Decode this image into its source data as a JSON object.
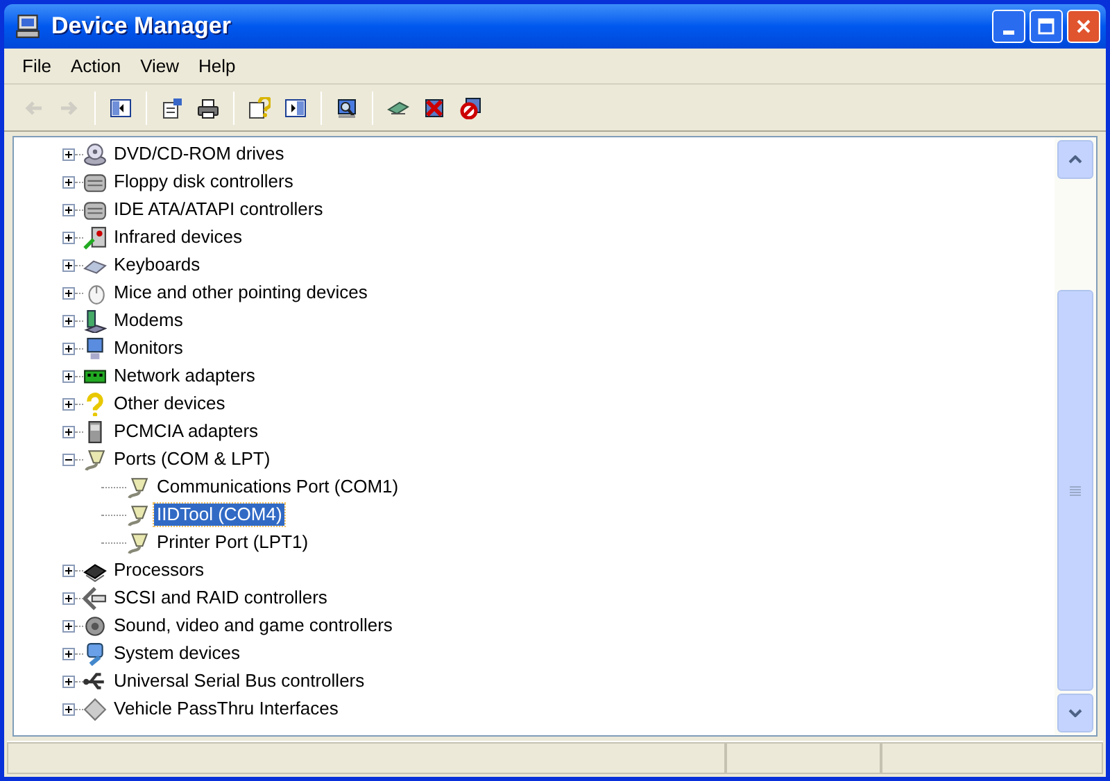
{
  "window": {
    "title": "Device Manager"
  },
  "menu": [
    "File",
    "Action",
    "View",
    "Help"
  ],
  "toolbar": [
    {
      "kind": "back",
      "disabled": true
    },
    {
      "kind": "forward",
      "disabled": true
    },
    {
      "kind": "separator"
    },
    {
      "kind": "tree",
      "disabled": false
    },
    {
      "kind": "separator"
    },
    {
      "kind": "properties",
      "disabled": false
    },
    {
      "kind": "print",
      "disabled": false
    },
    {
      "kind": "separator"
    },
    {
      "kind": "help",
      "disabled": false
    },
    {
      "kind": "pane",
      "disabled": false
    },
    {
      "kind": "separator"
    },
    {
      "kind": "scan",
      "disabled": false
    },
    {
      "kind": "separator"
    },
    {
      "kind": "update",
      "disabled": false
    },
    {
      "kind": "uninstall",
      "disabled": false
    },
    {
      "kind": "disable",
      "disabled": false
    }
  ],
  "tree": [
    {
      "label": "DVD/CD-ROM drives",
      "kind": "disc",
      "expanded": false,
      "selected": false
    },
    {
      "label": "Floppy disk controllers",
      "kind": "drive",
      "expanded": false,
      "selected": false
    },
    {
      "label": "IDE ATA/ATAPI controllers",
      "kind": "drive",
      "expanded": false,
      "selected": false
    },
    {
      "label": "Infrared devices",
      "kind": "infrared",
      "expanded": false,
      "selected": false
    },
    {
      "label": "Keyboards",
      "kind": "keyboard",
      "expanded": false,
      "selected": false
    },
    {
      "label": "Mice and other pointing devices",
      "kind": "mouse",
      "expanded": false,
      "selected": false
    },
    {
      "label": "Modems",
      "kind": "modem",
      "expanded": false,
      "selected": false
    },
    {
      "label": "Monitors",
      "kind": "monitor",
      "expanded": false,
      "selected": false
    },
    {
      "label": "Network adapters",
      "kind": "network",
      "expanded": false,
      "selected": false
    },
    {
      "label": "Other devices",
      "kind": "unknown",
      "expanded": false,
      "selected": false
    },
    {
      "label": "PCMCIA adapters",
      "kind": "card",
      "expanded": false,
      "selected": false
    },
    {
      "label": "Ports (COM & LPT)",
      "kind": "port",
      "expanded": true,
      "selected": false,
      "children": [
        {
          "label": "Communications Port (COM1)",
          "kind": "port",
          "selected": false
        },
        {
          "label": "IIDTool (COM4)",
          "kind": "port",
          "selected": true
        },
        {
          "label": "Printer Port (LPT1)",
          "kind": "port",
          "selected": false
        }
      ]
    },
    {
      "label": "Processors",
      "kind": "chip",
      "expanded": false,
      "selected": false
    },
    {
      "label": "SCSI and RAID controllers",
      "kind": "scsi",
      "expanded": false,
      "selected": false
    },
    {
      "label": "Sound, video and game controllers",
      "kind": "sound",
      "expanded": false,
      "selected": false
    },
    {
      "label": "System devices",
      "kind": "system",
      "expanded": false,
      "selected": false
    },
    {
      "label": "Universal Serial Bus controllers",
      "kind": "usb",
      "expanded": false,
      "selected": false
    },
    {
      "label": "Vehicle PassThru Interfaces",
      "kind": "diamond",
      "expanded": false,
      "selected": false
    }
  ]
}
